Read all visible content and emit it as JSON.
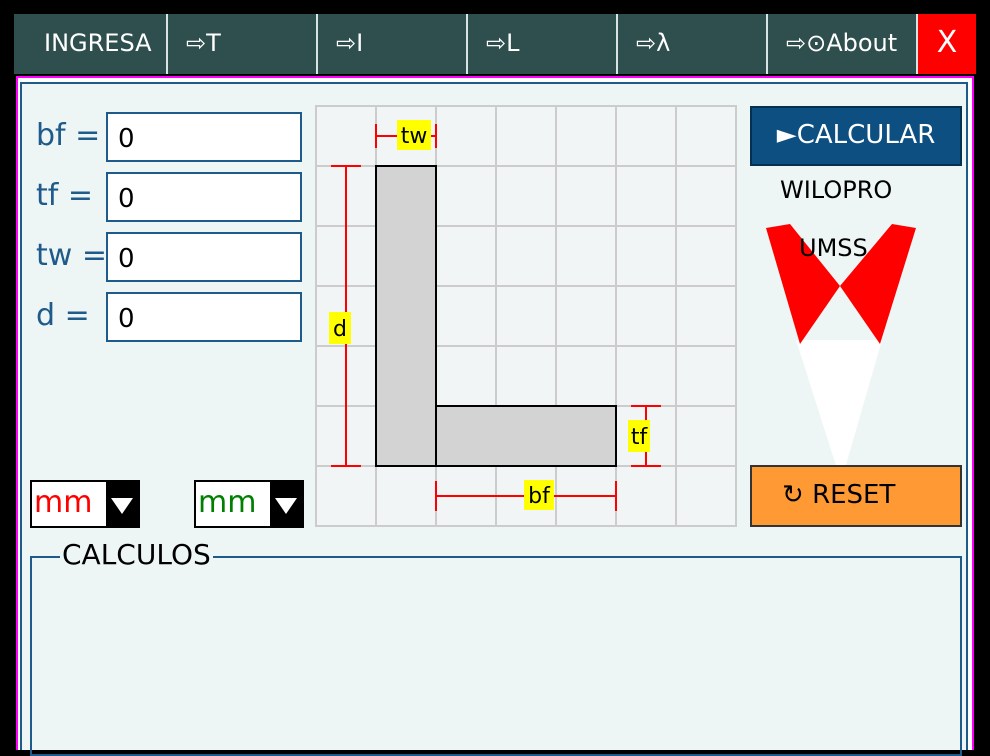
{
  "tabs": [
    {
      "label": "INGRESA"
    },
    {
      "label": "⇨T"
    },
    {
      "label": "⇨I"
    },
    {
      "label": "⇨L"
    },
    {
      "label": "⇨λ"
    },
    {
      "label": "⇨⊙About"
    }
  ],
  "close_label": "X",
  "inputs": {
    "bf": {
      "label": "bf =",
      "value": "0"
    },
    "tf": {
      "label": "tf =",
      "value": "0"
    },
    "tw": {
      "label": "tw =",
      "value": "0"
    },
    "d": {
      "label": "d =",
      "value": "0"
    }
  },
  "units": {
    "input_unit": "mm",
    "output_unit": "mm"
  },
  "diagram": {
    "tw": "tw",
    "d": "d",
    "tf": "tf",
    "bf": "bf"
  },
  "buttons": {
    "calculate": "►CALCULAR",
    "reset_icon": "↻",
    "reset": "RESET"
  },
  "branding": {
    "author": "WILOPRO",
    "university": "UMSS"
  },
  "calculations": {
    "title": "CALCULOS"
  },
  "colors": {
    "tab_bg": "#2f4f4f",
    "close_bg": "#ff0000",
    "accent_blue": "#1e5a8a",
    "calc_button": "#0e4f82",
    "reset_button": "#ff9933",
    "dimension_line": "#ff0000",
    "dimension_label_bg": "#ffff00",
    "section_fill": "#d3d3d3",
    "input_unit_color": "#ff0000",
    "output_unit_color": "#008000"
  }
}
